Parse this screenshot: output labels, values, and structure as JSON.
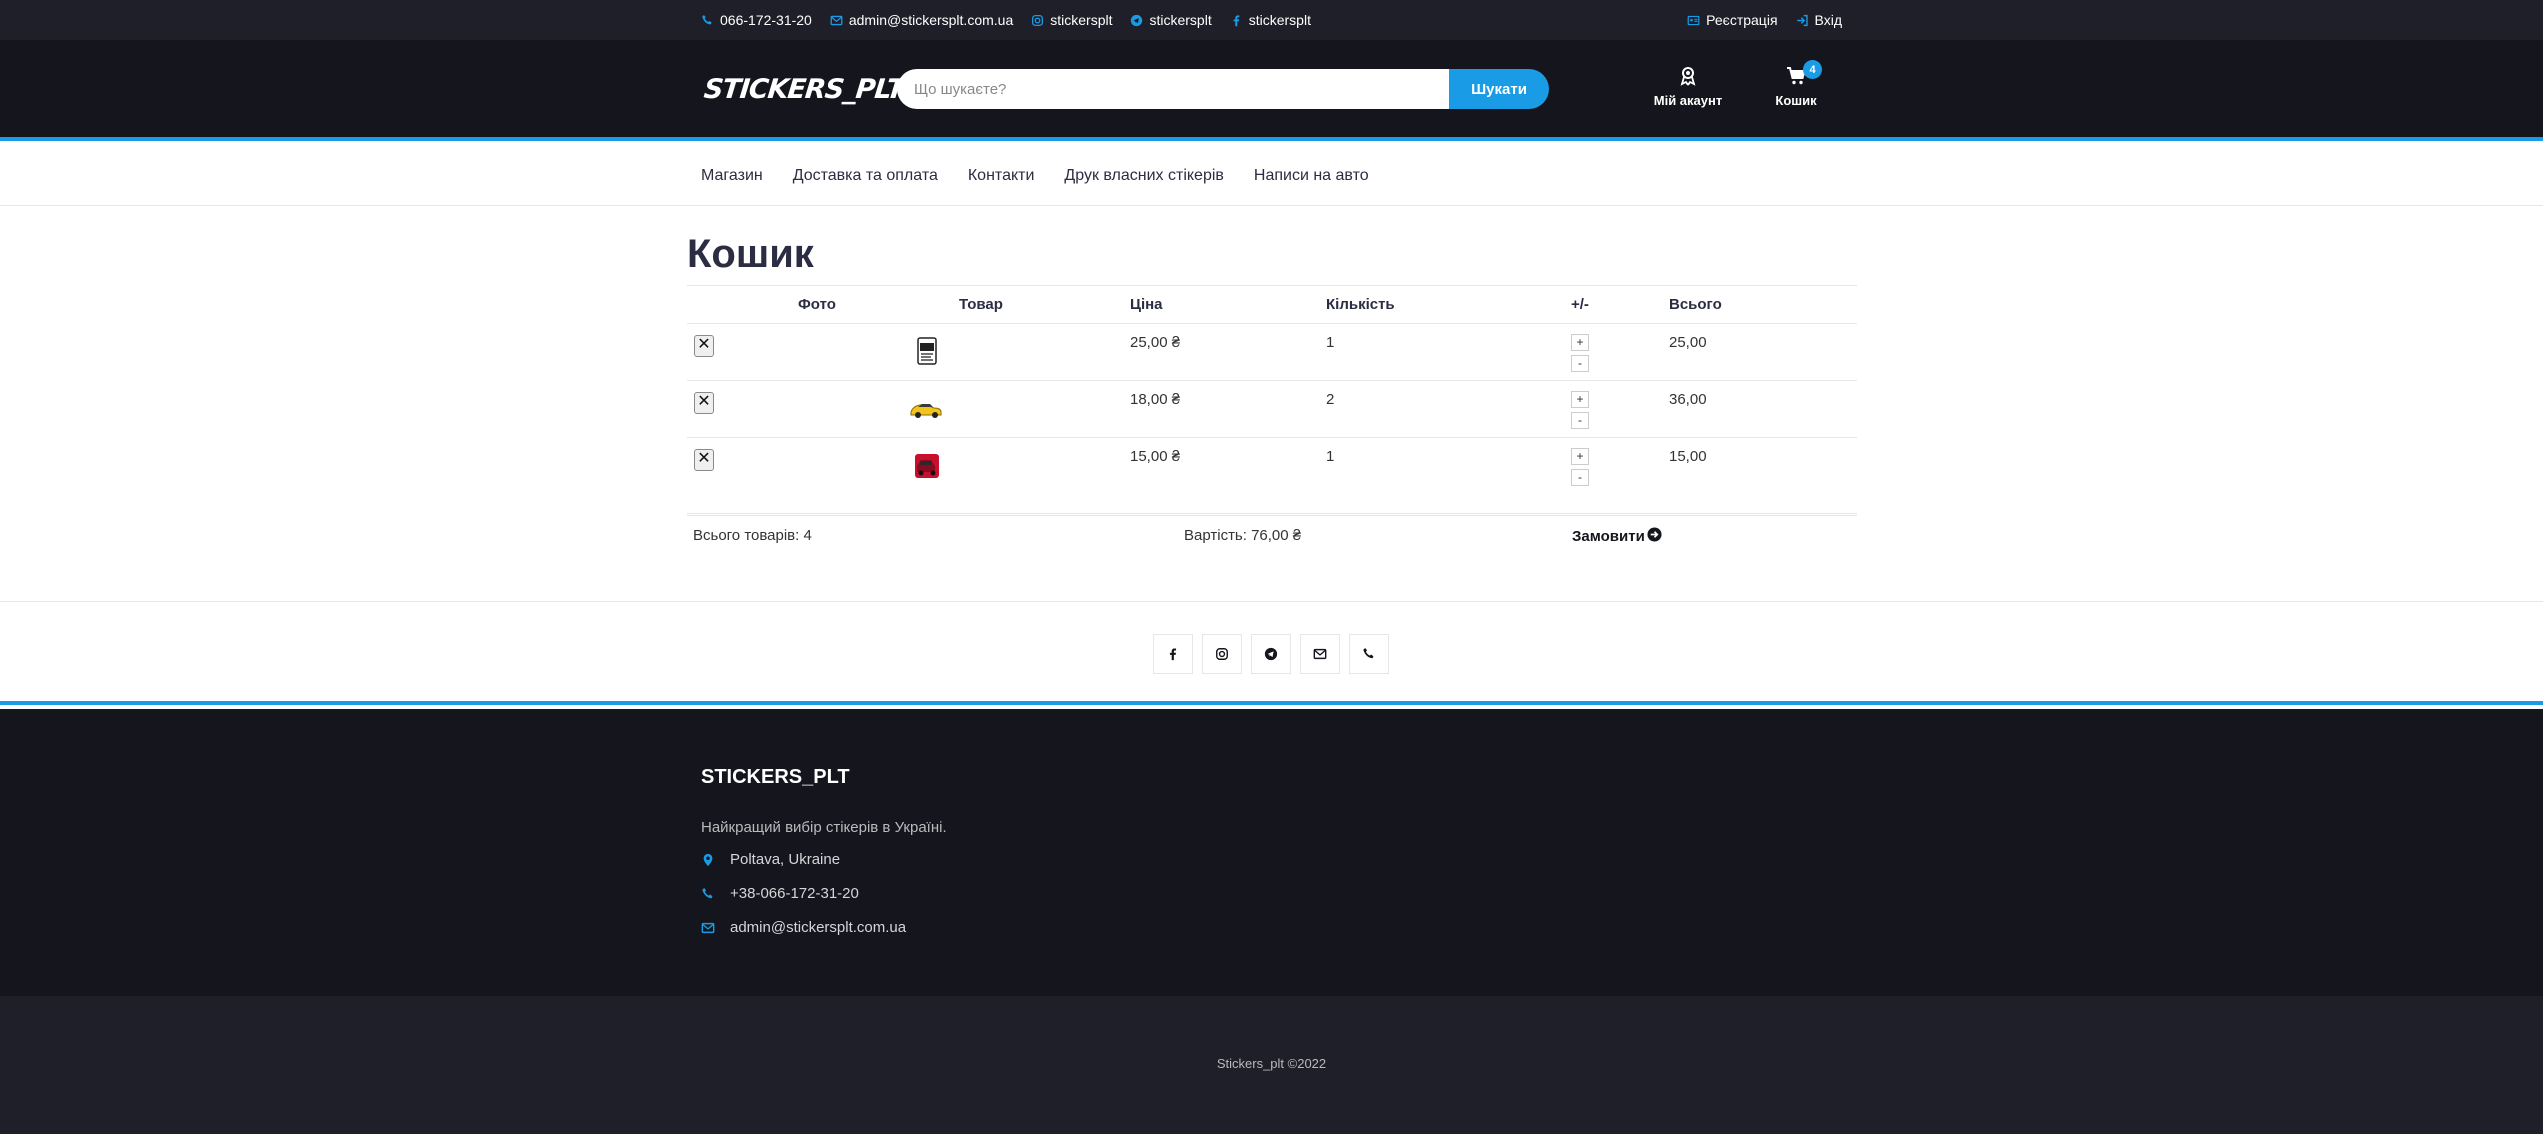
{
  "topbar": {
    "phone": "066-172-31-20",
    "email": "admin@stickersplt.com.ua",
    "instagram": "stickersplt",
    "telegram": "stickersplt",
    "facebook": "stickersplt",
    "register": "Реєстрація",
    "login": "Вхід"
  },
  "header": {
    "logo": "STICKERS_PLT",
    "search_placeholder": "Що шукаєте?",
    "search_button": "Шукати",
    "account_label": "Мій акаунт",
    "cart_label": "Кошик",
    "cart_count": "4"
  },
  "nav": {
    "items": [
      "Магазин",
      "Доставка та оплата",
      "Контакти",
      "Друк власних стікерів",
      "Написи на авто"
    ]
  },
  "page": {
    "title": "Кошик"
  },
  "cart": {
    "headers": [
      "",
      "Фото",
      "Товар",
      "Ціна",
      "Кількість",
      "+/-",
      "Всього"
    ],
    "remove_symbol": "✕",
    "plus": "+",
    "minus": "-",
    "rows": [
      {
        "product": "",
        "price": "25,00 ₴",
        "qty": "1",
        "total": "25,00",
        "thumb": "sticker-bw-icon"
      },
      {
        "product": "",
        "price": "18,00 ₴",
        "qty": "2",
        "total": "36,00",
        "thumb": "yellow-car-icon"
      },
      {
        "product": "",
        "price": "15,00 ₴",
        "qty": "1",
        "total": "15,00",
        "thumb": "red-car-icon"
      }
    ],
    "total_items": "Всього товарів: 4",
    "total_price": "Вартість: 76,00 ₴",
    "checkout": "Замовити"
  },
  "footer": {
    "brand": "STICKERS_PLT",
    "tagline": "Найкращий вибір стікерів в Україні.",
    "address": "Poltava, Ukraine",
    "phone": "+38-066-172-31-20",
    "email": "admin@stickersplt.com.ua",
    "copyright": "Stickers_plt ©2022"
  },
  "colors": {
    "accent": "#1a9be6",
    "dark": "#15161d",
    "topbar": "#1e1f29",
    "logo_dot": "#f00000"
  }
}
